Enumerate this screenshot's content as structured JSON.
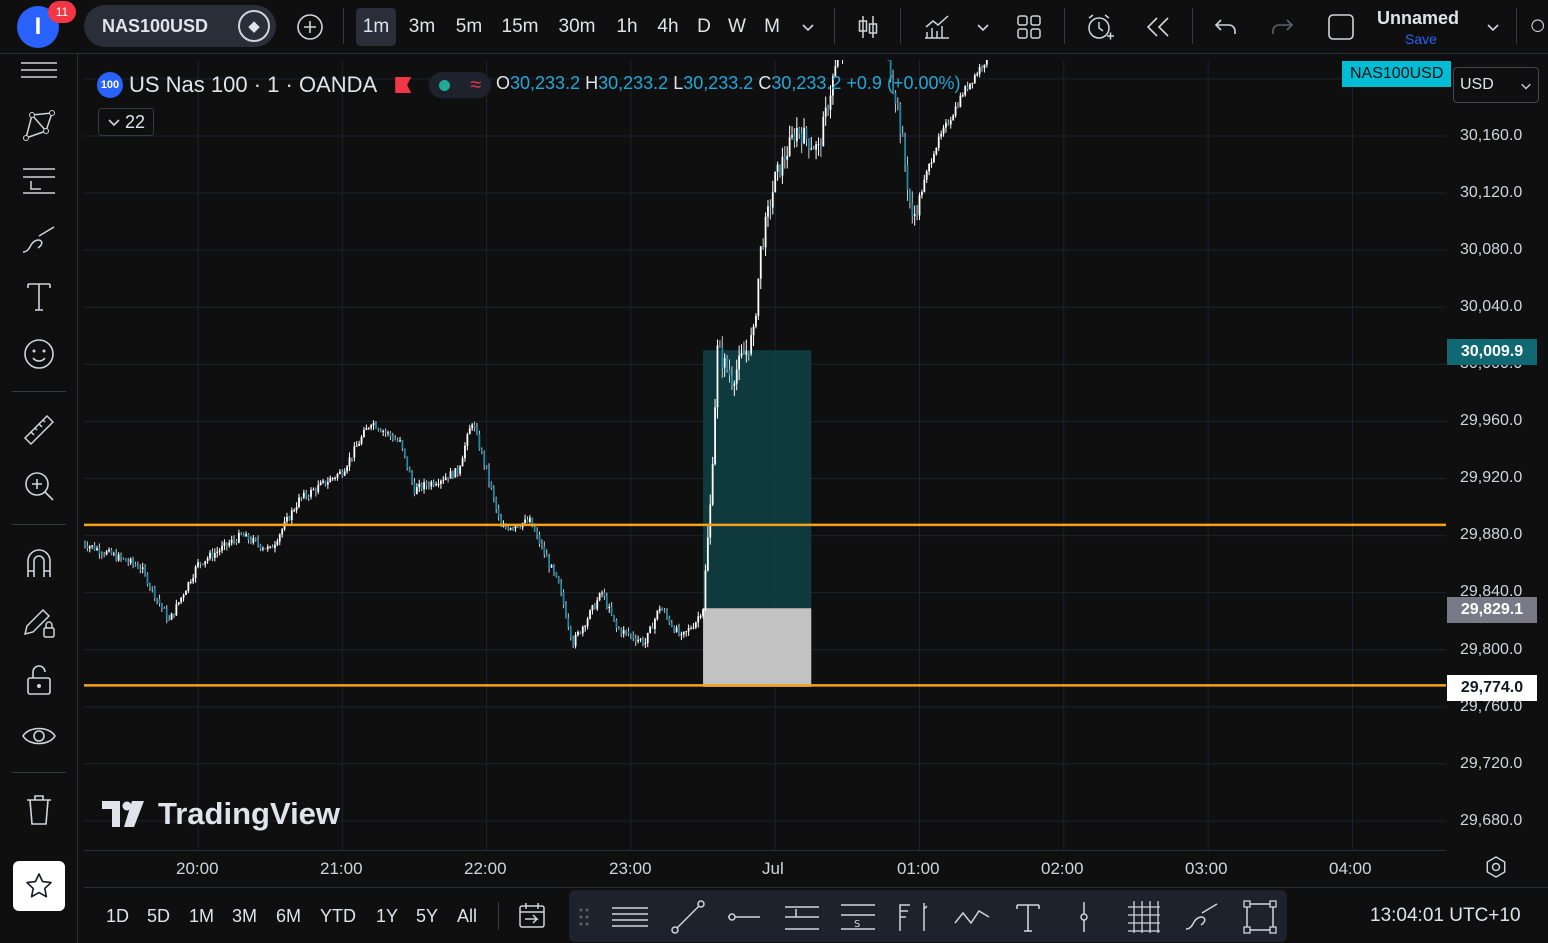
{
  "topbar": {
    "avatar_letter": "I",
    "notifications": "11",
    "symbol": "NAS100USD",
    "timeframes": [
      "1m",
      "3m",
      "5m",
      "15m",
      "30m",
      "1h",
      "4h",
      "D",
      "W",
      "M"
    ],
    "active_timeframe": "1m",
    "layout_name": "Unnamed",
    "save_label": "Save"
  },
  "legend": {
    "logo_text": "100",
    "title": "US Nas 100 · 1 · OANDA",
    "o_label": "O",
    "o": "30,233.2",
    "h_label": "H",
    "h": "30,233.2",
    "l_label": "L",
    "l": "30,233.2",
    "c_label": "C",
    "c": "30,233.2",
    "change": "+0.9 (+0.00%)",
    "indicator_count": "22"
  },
  "price_scale": {
    "currency": "USD",
    "symbol_tag": "NAS100USD",
    "labels": [
      "30,160.0",
      "30,120.0",
      "30,080.0",
      "30,040.0",
      "30,000.0",
      "29,960.0",
      "29,920.0",
      "29,880.0",
      "29,840.0",
      "29,800.0",
      "29,760.0",
      "29,720.0",
      "29,680.0"
    ],
    "tag_target": "30,009.9",
    "tag_current": "29,829.1",
    "tag_stop": "29,774.0",
    "colors": {
      "target": "#0f6872",
      "current": "#787b86",
      "stop": "#ffffff",
      "line": "#f7a21b",
      "profit": "#0e3f44",
      "loss": "#c2c2c2"
    }
  },
  "chart_data": {
    "type": "candlestick",
    "symbol": "NAS100USD",
    "interval": "1m",
    "ylim": [
      29660,
      30250
    ],
    "horizontal_lines": [
      29887.5,
      29775.0
    ],
    "position": {
      "entry": 29829.1,
      "target": 30009.9,
      "stop": 29774.0,
      "start_time": "23:30",
      "end_time": "00:15"
    },
    "x_ticks": [
      "20:00",
      "21:00",
      "22:00",
      "23:00",
      "Jul",
      "01:00",
      "02:00",
      "03:00",
      "04:00"
    ],
    "grid": true,
    "path_anchors": [
      [
        19.2,
        29875
      ],
      [
        19.6,
        29858
      ],
      [
        19.8,
        29820
      ],
      [
        20.0,
        29860
      ],
      [
        20.3,
        29880
      ],
      [
        20.5,
        29870
      ],
      [
        20.7,
        29905
      ],
      [
        21.0,
        29925
      ],
      [
        21.2,
        29960
      ],
      [
        21.4,
        29945
      ],
      [
        21.5,
        29912
      ],
      [
        21.8,
        29925
      ],
      [
        21.9,
        29960
      ],
      [
        22.0,
        29925
      ],
      [
        22.1,
        29885
      ],
      [
        22.3,
        29890
      ],
      [
        22.5,
        29845
      ],
      [
        22.6,
        29805
      ],
      [
        22.8,
        29840
      ],
      [
        22.9,
        29815
      ],
      [
        23.1,
        29805
      ],
      [
        23.2,
        29830
      ],
      [
        23.35,
        29808
      ],
      [
        23.45,
        29820
      ],
      [
        23.5,
        29830
      ],
      [
        23.55,
        29900
      ],
      [
        23.6,
        30010
      ],
      [
        23.7,
        29990
      ],
      [
        23.85,
        30020
      ],
      [
        23.9,
        30080
      ],
      [
        24.0,
        30130
      ],
      [
        24.15,
        30165
      ],
      [
        24.3,
        30150
      ],
      [
        24.4,
        30200
      ],
      [
        24.5,
        30240
      ],
      [
        24.75,
        30230
      ],
      [
        24.85,
        30180
      ],
      [
        24.95,
        30100
      ],
      [
        25.1,
        30150
      ],
      [
        25.3,
        30190
      ],
      [
        25.5,
        30220
      ],
      [
        25.65,
        30240
      ],
      [
        25.8,
        30240
      ]
    ]
  },
  "time_axis": [
    "20:00",
    "21:00",
    "22:00",
    "23:00",
    "Jul",
    "01:00",
    "02:00",
    "03:00",
    "04:00"
  ],
  "bottom": {
    "ranges": [
      "1D",
      "5D",
      "1M",
      "3M",
      "6M",
      "YTD",
      "1Y",
      "5Y",
      "All"
    ],
    "clock": "13:04:01 UTC+10"
  },
  "watermark": "TradingView"
}
